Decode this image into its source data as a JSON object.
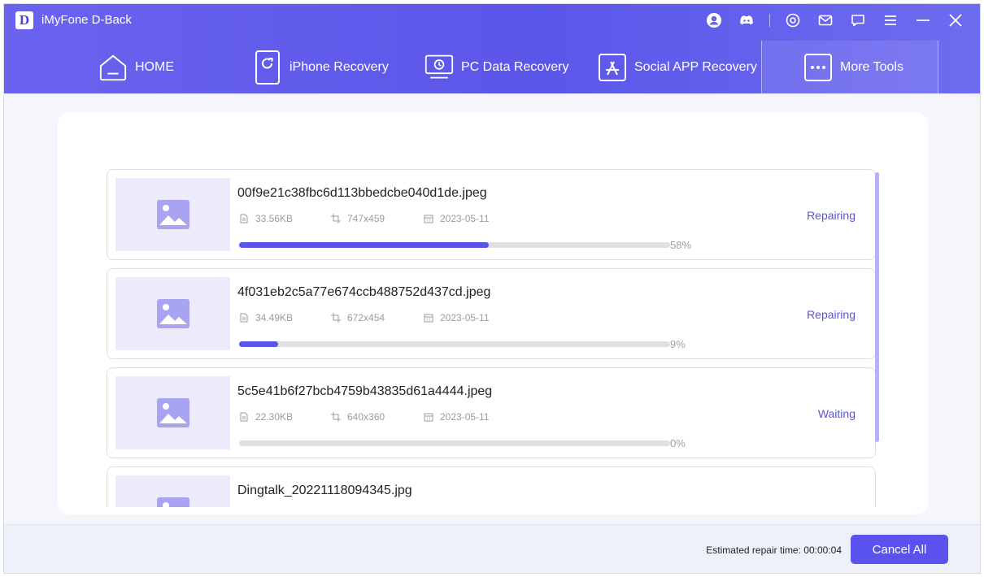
{
  "app": {
    "logo_letter": "D",
    "title": "iMyFone D-Back"
  },
  "titlebar_icons": [
    "account-icon",
    "discord-icon",
    "settings-icon",
    "mail-icon",
    "feedback-icon",
    "menu-icon",
    "minimize-icon",
    "close-icon"
  ],
  "nav": [
    {
      "label": "HOME",
      "icon": "home-icon"
    },
    {
      "label": "iPhone Recovery",
      "icon": "iphone-icon"
    },
    {
      "label": "PC Data Recovery",
      "icon": "pc-icon"
    },
    {
      "label": "Social APP Recovery",
      "icon": "app-store-icon"
    },
    {
      "label": "More Tools",
      "icon": "more-icon",
      "active": true
    }
  ],
  "files": [
    {
      "name": "00f9e21c38fbc6d113bbedcbe040d1de.jpeg",
      "size": "33.56KB",
      "dimensions": "747x459",
      "date": "2023-05-11",
      "progress": 58,
      "progress_label": "58%",
      "status": "Repairing"
    },
    {
      "name": "4f031eb2c5a77e674ccb488752d437cd.jpeg",
      "size": "34.49KB",
      "dimensions": "672x454",
      "date": "2023-05-11",
      "progress": 9,
      "progress_label": "9%",
      "status": "Repairing"
    },
    {
      "name": "5c5e41b6f27bcb4759b43835d61a4444.jpeg",
      "size": "22.30KB",
      "dimensions": "640x360",
      "date": "2023-05-11",
      "progress": 0,
      "progress_label": "0%",
      "status": "Waiting"
    },
    {
      "name": "Dingtalk_20221118094345.jpg",
      "size": "",
      "dimensions": "",
      "date": "",
      "progress": 0,
      "progress_label": "",
      "status": ""
    }
  ],
  "footer": {
    "estimate": "Estimated repair time: 00:00:04",
    "cancel_label": "Cancel All"
  },
  "colors": {
    "accent": "#5a52ee",
    "header": "#6a63ee",
    "thumb_bg": "#edebfb",
    "status_text": "#5a54d8"
  }
}
